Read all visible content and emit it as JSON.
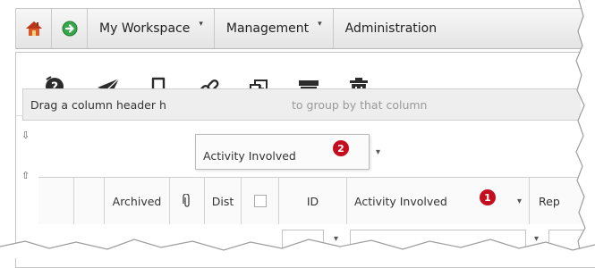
{
  "nav": {
    "menus": [
      {
        "label": "My Workspace",
        "has_caret": true
      },
      {
        "label": "Management",
        "has_caret": true
      },
      {
        "label": "Administration",
        "has_caret": false
      }
    ],
    "caret_glyph": "▾"
  },
  "toolbar": {
    "icons": [
      "help-mail-icon",
      "send-icon",
      "bookmark-icon",
      "link-icon",
      "copy-icon",
      "archive-icon",
      "delete-icon"
    ]
  },
  "grid": {
    "group_bar_text": "Drag a column header h",
    "group_bar_text_hidden": "to group by that column",
    "drag_chip_label": "Activity Involved",
    "columns": [
      "Archived",
      "Dist",
      "ID",
      "Activity Involved",
      "Rep"
    ],
    "filter_glyph": "▾"
  },
  "badges": [
    "1",
    "2"
  ],
  "colors": {
    "badge": "#c40d1e",
    "nav_bg": "#eaeaea",
    "group_bar": "#eeeeee"
  }
}
